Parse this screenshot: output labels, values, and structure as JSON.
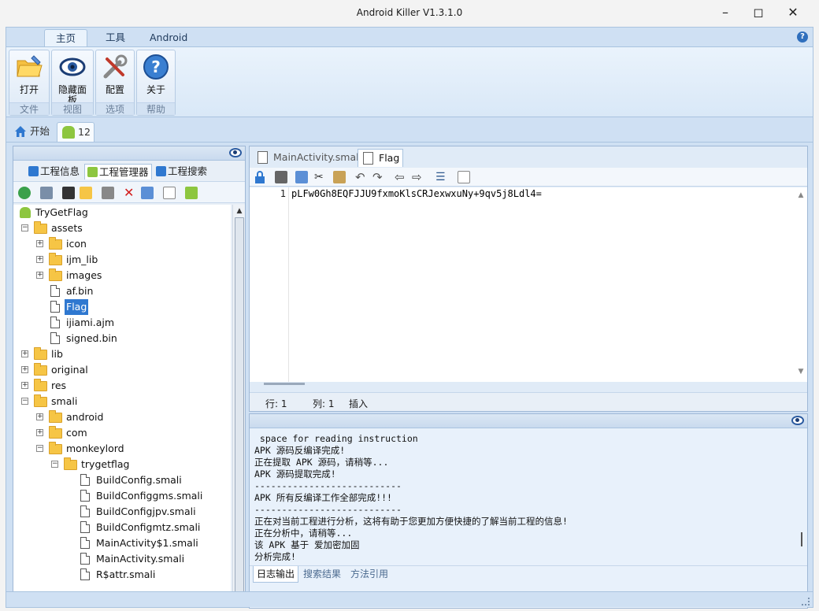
{
  "window": {
    "title": "Android Killer V1.3.1.0"
  },
  "ribbon": {
    "tabs": [
      {
        "label": "主页",
        "active": true
      },
      {
        "label": "工具",
        "active": false
      },
      {
        "label": "Android",
        "active": false
      }
    ],
    "groups": [
      {
        "button": "打开",
        "group": "文件",
        "icon": "folder-open-icon"
      },
      {
        "button": "隐藏面板",
        "group": "视图",
        "icon": "eye-icon"
      },
      {
        "button": "配置",
        "group": "选项",
        "icon": "tools-icon"
      },
      {
        "button": "关于",
        "group": "帮助",
        "icon": "help-icon"
      }
    ]
  },
  "doc_tabs": [
    {
      "label": "开始",
      "icon": "home-icon"
    },
    {
      "label": "12",
      "icon": "android-icon",
      "active": true
    }
  ],
  "left_tabs": [
    {
      "label": "工程信息"
    },
    {
      "label": "工程管理器",
      "active": true
    },
    {
      "label": "工程搜索"
    }
  ],
  "tree": [
    {
      "label": "TryGetFlag",
      "type": "android",
      "level": 0
    },
    {
      "label": "assets",
      "type": "folder",
      "level": 0,
      "expanded": true
    },
    {
      "label": "icon",
      "type": "folder",
      "level": 1,
      "expanded": false
    },
    {
      "label": "ijm_lib",
      "type": "folder",
      "level": 1,
      "expanded": false
    },
    {
      "label": "images",
      "type": "folder",
      "level": 1,
      "expanded": false
    },
    {
      "label": "af.bin",
      "type": "file",
      "level": 1
    },
    {
      "label": "Flag",
      "type": "file",
      "level": 1,
      "selected": true
    },
    {
      "label": "ijiami.ajm",
      "type": "file",
      "level": 1
    },
    {
      "label": "signed.bin",
      "type": "file",
      "level": 1
    },
    {
      "label": "lib",
      "type": "folder",
      "level": 0,
      "expanded": false
    },
    {
      "label": "original",
      "type": "folder",
      "level": 0,
      "expanded": false
    },
    {
      "label": "res",
      "type": "folder",
      "level": 0,
      "expanded": false
    },
    {
      "label": "smali",
      "type": "folder",
      "level": 0,
      "expanded": true
    },
    {
      "label": "android",
      "type": "folder",
      "level": 1,
      "expanded": false
    },
    {
      "label": "com",
      "type": "folder",
      "level": 1,
      "expanded": false
    },
    {
      "label": "monkeylord",
      "type": "folder",
      "level": 1,
      "expanded": true
    },
    {
      "label": "trygetflag",
      "type": "folder",
      "level": 2,
      "expanded": true
    },
    {
      "label": "BuildConfig.smali",
      "type": "file",
      "level": 3
    },
    {
      "label": "BuildConfiggms.smali",
      "type": "file",
      "level": 3
    },
    {
      "label": "BuildConfigjpv.smali",
      "type": "file",
      "level": 3
    },
    {
      "label": "BuildConfigmtz.smali",
      "type": "file",
      "level": 3
    },
    {
      "label": "MainActivity$1.smali",
      "type": "file",
      "level": 3
    },
    {
      "label": "MainActivity.smali",
      "type": "file",
      "level": 3
    },
    {
      "label": "R$attr.smali",
      "type": "file",
      "level": 3
    }
  ],
  "editor": {
    "tabs": [
      {
        "label": "MainActivity.smali",
        "active": false
      },
      {
        "label": "Flag",
        "active": true
      }
    ],
    "line_number": "1",
    "content": "pLFw0Gh8EQFJJU9fxmoKlsCRJexwxuNy+9qv5j8Ldl4=",
    "status": {
      "row": "行: 1",
      "col": "列: 1",
      "mode": "插入"
    }
  },
  "log": {
    "lines": [
      " space for reading instruction",
      "APK 源码反编译完成!",
      "正在提取 APK 源码，请稍等...",
      "APK 源码提取完成!",
      "---------------------------",
      "APK 所有反编译工作全部完成!!!",
      "---------------------------",
      "正在对当前工程进行分析，这将有助于您更加方便快捷的了解当前工程的信息!",
      "正在分析中，请稍等...",
      "该 APK 基于 爱加密加固",
      "分析完成!"
    ],
    "tabs": [
      {
        "label": "日志输出",
        "active": true
      },
      {
        "label": "搜索结果",
        "active": false
      },
      {
        "label": "方法引用",
        "active": false
      }
    ]
  }
}
